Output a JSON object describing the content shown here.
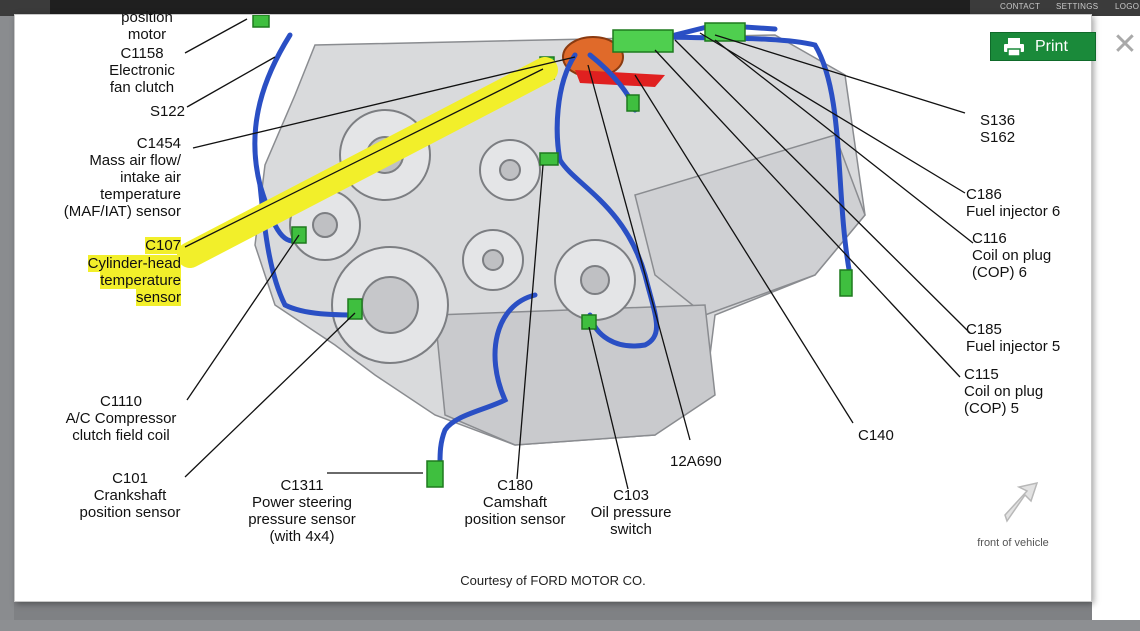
{
  "nav": {
    "contact": "CONTACT",
    "settings": "SETTINGS",
    "logout": "LOGO"
  },
  "toolbar": {
    "print_label": "Print",
    "close_glyph": "✕"
  },
  "labels": {
    "position_motor": "position\nmotor",
    "c1158": "C1158\nElectronic\nfan clutch",
    "s122": "S122",
    "c1454": "C1454\nMass air flow/\nintake air\ntemperature\n(MAF/IAT) sensor",
    "c107_code": "C107",
    "c107_name_1": "Cylinder-head",
    "c107_name_2": "temperature",
    "c107_name_3": "sensor",
    "c1110": "C1110\nA/C Compressor\nclutch field coil",
    "c101": "C101\nCrankshaft\nposition sensor",
    "c1311": "C1311\nPower steering\npressure sensor\n(with 4x4)",
    "c180": "C180\nCamshaft\nposition sensor",
    "c103": "C103\nOil pressure\nswitch",
    "p12a690": "12A690",
    "c140": "C140",
    "s136": "S136\nS162",
    "c186": "C186\nFuel injector 6",
    "c116": "C116\nCoil on plug\n(COP) 6",
    "c185": "C185\nFuel injector 5",
    "c115": "C115\nCoil on plug\n(COP) 5"
  },
  "footer": {
    "courtesy": "Courtesy of FORD MOTOR CO.",
    "front_of_vehicle": "front of vehicle"
  },
  "colors": {
    "harness": "#2a4fc4",
    "connector": "#3fbf3f",
    "highlight": "#f2ef2a",
    "print_green": "#1a8a3a",
    "engine": "#d9dadc"
  }
}
